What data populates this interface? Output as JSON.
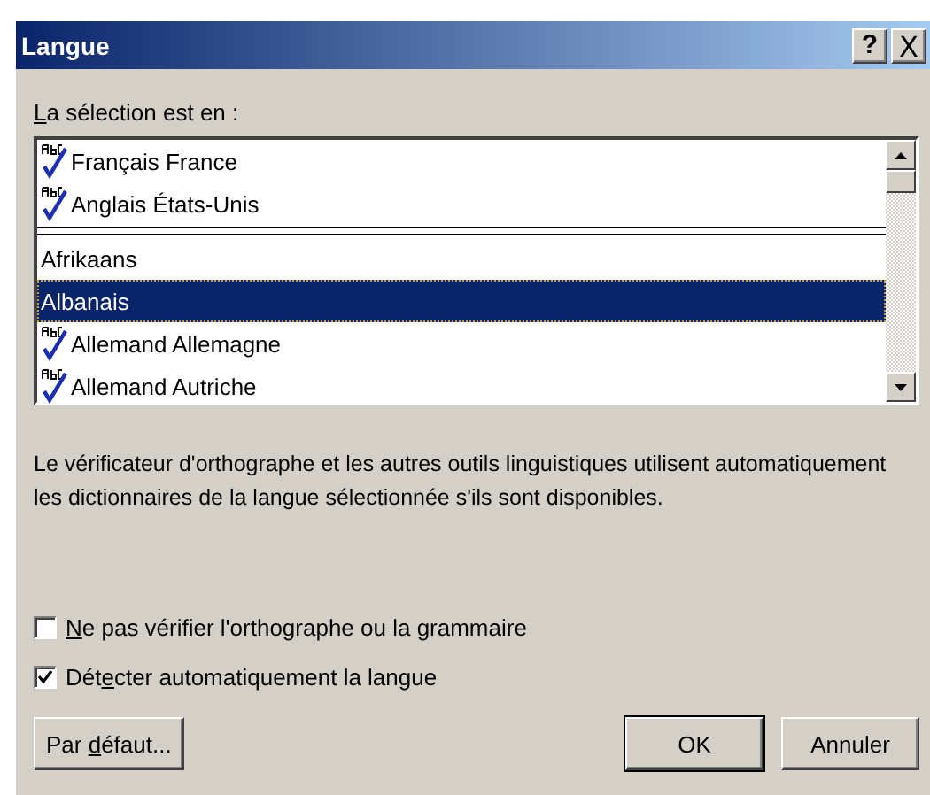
{
  "window": {
    "title": "Langue",
    "title_buttons": [
      {
        "kind": "help",
        "glyph": "?"
      },
      {
        "kind": "close",
        "glyph": "X"
      }
    ]
  },
  "selection_label": {
    "key": "L",
    "post": "a sélection est en :"
  },
  "recent_languages": [
    {
      "name": "Français France",
      "spellcheck": true,
      "selected": false
    },
    {
      "name": "Anglais États-Unis",
      "spellcheck": true,
      "selected": false
    }
  ],
  "languages": [
    {
      "name": "Afrikaans",
      "spellcheck": false,
      "selected": false
    },
    {
      "name": "Albanais",
      "spellcheck": false,
      "selected": true
    },
    {
      "name": "Allemand Allemagne",
      "spellcheck": true,
      "selected": false
    },
    {
      "name": "Allemand Autriche",
      "spellcheck": true,
      "selected": false
    }
  ],
  "description": "Le vérificateur d'orthographe et les autres outils linguistiques utilisent automatiquement les dictionnaires de la langue sélectionnée s'ils sont disponibles.",
  "options": [
    {
      "key": "N",
      "post": "e pas vérifier l'orthographe ou la grammaire",
      "checked": false
    },
    {
      "pre": "Dét",
      "key": "e",
      "post": "cter automatiquement la langue",
      "checked": true
    }
  ],
  "buttons": [
    {
      "pre": "Par ",
      "key": "d",
      "post": "éfaut...",
      "kind": "secondary"
    },
    {
      "pre": "OK",
      "kind": "default"
    },
    {
      "pre": "Annuler",
      "kind": "normal"
    }
  ]
}
